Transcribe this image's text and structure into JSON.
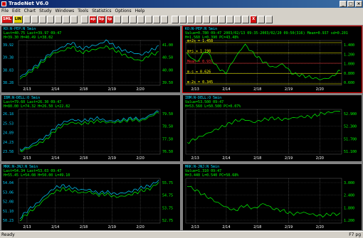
{
  "window": {
    "title": "TradeNet V6.0",
    "min": "_",
    "max": "□",
    "close": "×"
  },
  "menu": [
    "File",
    "Edit",
    "Chart",
    "Study",
    "Windows",
    "Tools",
    "Statistics",
    "Options",
    "Help"
  ],
  "toolbar": [
    "SML",
    "LIN",
    "",
    "",
    "",
    "",
    "",
    "",
    "",
    "",
    "ap",
    "bp",
    "tp",
    "",
    "",
    "",
    "",
    "",
    "",
    "",
    "",
    "",
    "",
    "",
    "",
    "",
    "",
    "",
    "",
    "",
    "X",
    "",
    ""
  ],
  "toolbar_colors": [
    "red",
    "yel",
    "",
    "",
    "",
    "",
    "",
    "",
    "",
    "",
    "red",
    "red",
    "red",
    "",
    "",
    "",
    "",
    "",
    "",
    "",
    "",
    "",
    "",
    "",
    "",
    "",
    "",
    "",
    "",
    "",
    "red",
    "",
    ""
  ],
  "status": {
    "left": "Ready",
    "right": "F7 pg"
  },
  "panels": [
    {
      "id": "ko-pep",
      "active": false,
      "line1": "KO:N-PEP:N 5min",
      "line2": "Last=40.75 Last=39.97 09:47",
      "line3": "H=39.30 H=40.49 L=38.02",
      "xlabels": [
        "2/13",
        "2/14",
        "2/18",
        "2/19",
        "2/20"
      ],
      "ylabelsL": [
        "39.92",
        "39.38",
        "38.83",
        "38.28"
      ],
      "ylabelsR": [
        "41.00",
        "40.50",
        "40.00",
        "39.50"
      ],
      "chart_data": {
        "type": "line",
        "categories": [
          "2/13",
          "2/14",
          "2/18",
          "2/19",
          "2/20"
        ],
        "series": [
          {
            "name": "KO:N",
            "color": "#00ff00",
            "values": [
              38.3,
              38.6,
              38.9,
              39.3,
              39.6,
              39.7,
              39.9,
              39.6,
              39.7,
              39.8,
              39.9,
              39.7,
              39.5,
              39.3,
              39.2,
              39.5,
              39.6
            ]
          },
          {
            "name": "PEP:N",
            "color": "#00d0ff",
            "values": [
              38.4,
              38.7,
              39.0,
              39.4,
              39.7,
              39.9,
              40.1,
              39.8,
              39.9,
              40.0,
              40.2,
              39.9,
              39.7,
              39.6,
              39.5,
              39.7,
              39.9
            ]
          }
        ],
        "ylim": [
          38.0,
          40.2
        ]
      }
    },
    {
      "id": "ko-pep-ratio",
      "active": true,
      "line1": "KO:N-PEP:N 5min",
      "line2": "Value=0.780 09:47 2003/02/13 09:35-2003/02/20 09:50(316) Mean=0.937 sd=0.201",
      "line3": "H=1.560 L=0.390 PC=43.48%",
      "bands": [
        "m+2s = 1.458",
        "m+s = 1.198",
        "Mean = 0.937",
        "m-s = 0.626",
        "m-2s = 0.345"
      ],
      "xlabels": [
        "2/13",
        "2/14",
        "2/18",
        "2/19",
        "2/20"
      ],
      "ylabelsR": [
        "1.400",
        "1.200",
        "1.000",
        "0.800",
        "0.600"
      ],
      "chart_data": {
        "type": "line",
        "categories": [
          "2/13",
          "2/14",
          "2/18",
          "2/19",
          "2/20"
        ],
        "series": [
          {
            "name": "KO:N-PEP:N",
            "color": "#00ff00",
            "values": [
              1.2,
              1.0,
              1.3,
              0.9,
              0.7,
              1.1,
              1.45,
              1.2,
              1.0,
              0.85,
              0.95,
              0.7,
              0.65,
              0.6,
              0.55,
              0.6,
              0.78
            ]
          }
        ],
        "ylim": [
          0.4,
          1.55
        ]
      }
    },
    {
      "id": "ibm-dell",
      "active": false,
      "line1": "IBM:N-DELL:O 5min",
      "line2": "Last=79.60 Last=26.30 09:47",
      "line3": "H=80.00 L=74.32 H=26.50 L=22.82",
      "xlabels": [
        "2/13",
        "2/14",
        "2/18",
        "2/19",
        "2/20"
      ],
      "ylabelsL": [
        "26.18",
        "25.53",
        "24.89",
        "24.23",
        "23.58"
      ],
      "ylabelsR": [
        "79.50",
        "78.50",
        "77.50",
        "76.50"
      ],
      "chart_data": {
        "type": "line",
        "categories": [
          "2/13",
          "2/14",
          "2/18",
          "2/19",
          "2/20"
        ],
        "series": [
          {
            "name": "IBM:N",
            "color": "#00ff00",
            "values": [
              23.5,
              23.7,
              24.0,
              24.3,
              24.9,
              25.3,
              25.5,
              25.4,
              25.5,
              25.6,
              25.5,
              25.5,
              25.6,
              25.7,
              25.6,
              25.9,
              26.2
            ]
          },
          {
            "name": "DELL:O",
            "color": "#00d0ff",
            "values": [
              23.6,
              23.8,
              24.2,
              24.5,
              25.1,
              25.5,
              25.7,
              25.6,
              25.7,
              25.8,
              25.6,
              25.6,
              25.7,
              25.8,
              25.7,
              26.0,
              26.3
            ]
          }
        ],
        "ylim": [
          23.3,
          26.4
        ]
      }
    },
    {
      "id": "ibm-dell-ratio",
      "active": false,
      "line1": "IBM:N-DELL:O 5min",
      "line2": "Value=53.500 09:47",
      "line3": "H=53.560 L=50.500 PC=0.07%",
      "xlabels": [
        "2/13",
        "2/14",
        "2/18",
        "2/19",
        "2/20"
      ],
      "ylabelsR": [
        "52.900",
        "52.300",
        "51.700",
        "51.100"
      ],
      "chart_data": {
        "type": "line",
        "categories": [
          "2/13",
          "2/14",
          "2/18",
          "2/19",
          "2/20"
        ],
        "series": [
          {
            "name": "IBM:N-DELL:O",
            "color": "#00ff00",
            "values": [
              51.3,
              51.6,
              51.9,
              52.2,
              52.5,
              52.8,
              52.9,
              52.7,
              52.9,
              53.0,
              52.9,
              53.0,
              53.1,
              53.1,
              53.3,
              53.4,
              53.5
            ]
          }
        ],
        "ylim": [
          50.5,
          53.6
        ]
      }
    },
    {
      "id": "mrk-jnj",
      "active": false,
      "line1": "MRK:N-JNJ:N 5min",
      "line2": "Last=54.34 Last=53.03 09:47",
      "line3": "H=55.45 L=54.08 H=50.00 L=49.10",
      "xlabels": [
        "2/13",
        "2/14",
        "2/18",
        "2/19",
        "2/20"
      ],
      "ylabelsL": [
        "54.04",
        "53.06",
        "52.08",
        "51.10",
        "50.23"
      ],
      "ylabelsR": [
        "55.75",
        "54.75",
        "53.75",
        "52.75"
      ],
      "chart_data": {
        "type": "line",
        "categories": [
          "2/13",
          "2/14",
          "2/18",
          "2/19",
          "2/20"
        ],
        "series": [
          {
            "name": "MRK:N",
            "color": "#00ff00",
            "values": [
              50.3,
              51.0,
              51.6,
              52.4,
              53.0,
              53.3,
              53.1,
              52.9,
              53.0,
              52.7,
              52.8,
              52.5,
              52.6,
              52.8,
              53.1,
              53.3,
              53.9
            ]
          },
          {
            "name": "JNJ:N",
            "color": "#00d0ff",
            "values": [
              50.5,
              51.3,
              51.9,
              52.7,
              53.4,
              53.6,
              53.4,
              53.2,
              53.2,
              52.9,
              53.0,
              52.8,
              52.9,
              53.1,
              53.4,
              53.6,
              54.1
            ]
          }
        ],
        "ylim": [
          50.0,
          54.3
        ]
      }
    },
    {
      "id": "mrk-jnj-ratio",
      "active": false,
      "line1": "MRK:N-JNJ:N 5min",
      "line2": "Value=1.310 09:47",
      "line3": "H=3.440 L=0.540 PC=50.68%",
      "xlabels": [
        "2/13",
        "2/14",
        "2/18",
        "2/19",
        "2/20"
      ],
      "ylabelsR": [
        "3.000",
        "2.400",
        "1.800",
        "1.200"
      ],
      "chart_data": {
        "type": "line",
        "categories": [
          "2/13",
          "2/14",
          "2/18",
          "2/19",
          "2/20"
        ],
        "series": [
          {
            "name": "MRK:N-JNJ:N",
            "color": "#00ff00",
            "values": [
              2.9,
              2.6,
              2.3,
              2.0,
              1.7,
              1.5,
              1.8,
              1.6,
              1.9,
              1.6,
              1.5,
              1.3,
              1.4,
              1.3,
              1.2,
              1.3,
              1.3
            ]
          }
        ],
        "ylim": [
          0.8,
          3.3
        ]
      }
    }
  ]
}
